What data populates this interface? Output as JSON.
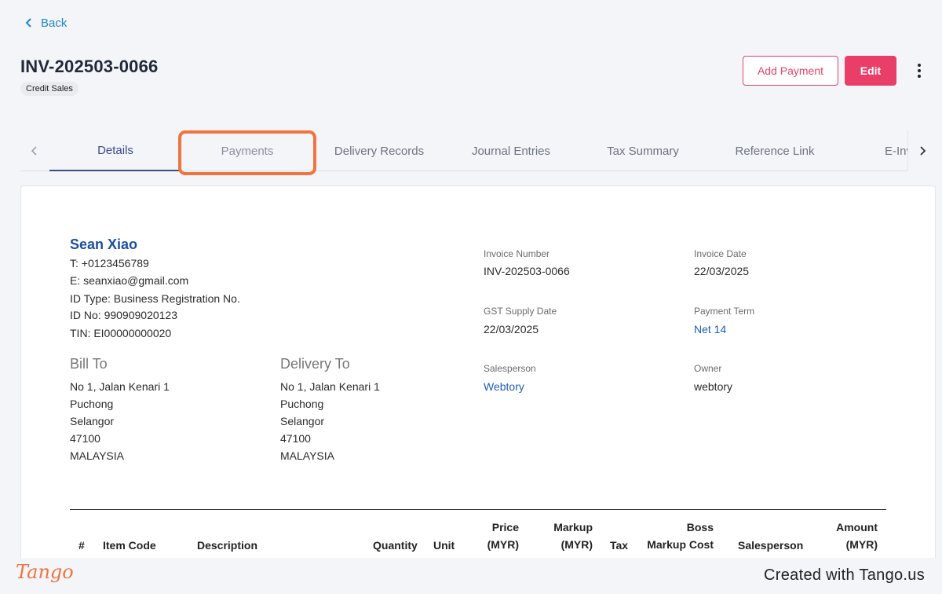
{
  "nav": {
    "back_label": "Back"
  },
  "header": {
    "invoice_no": "INV-202503-0066",
    "badge": "Credit Sales",
    "add_payment_label": "Add Payment",
    "edit_label": "Edit"
  },
  "tabs": [
    {
      "label": "Details"
    },
    {
      "label": "Payments"
    },
    {
      "label": "Delivery Records"
    },
    {
      "label": "Journal Entries"
    },
    {
      "label": "Tax Summary"
    },
    {
      "label": "Reference Link"
    },
    {
      "label": "E-Inv"
    }
  ],
  "customer": {
    "name": "Sean Xiao",
    "phone": "T: +0123456789",
    "email": "E: seanxiao@gmail.com",
    "id_type": "ID Type: Business Registration No.",
    "id_no": "ID No: 990909020123",
    "tin": "TIN: EI00000000020"
  },
  "bill_to": {
    "title": "Bill To",
    "lines": [
      "No 1, Jalan Kenari 1",
      "Puchong",
      "Selangor",
      "47100",
      "MALAYSIA"
    ]
  },
  "delivery_to": {
    "title": "Delivery To",
    "lines": [
      "No 1, Jalan Kenari 1",
      "Puchong",
      "Selangor",
      "47100",
      "MALAYSIA"
    ]
  },
  "meta": {
    "invoice_number_label": "Invoice Number",
    "invoice_number": "INV-202503-0066",
    "invoice_date_label": "Invoice Date",
    "invoice_date": "22/03/2025",
    "gst_supply_date_label": "GST Supply Date",
    "gst_supply_date": "22/03/2025",
    "payment_term_label": "Payment Term",
    "payment_term": "Net 14",
    "salesperson_label": "Salesperson",
    "salesperson": "Webtory",
    "owner_label": "Owner",
    "owner": "webtory"
  },
  "table_headers": {
    "num": "#",
    "item_code": "Item Code",
    "description": "Description",
    "quantity": "Quantity",
    "unit": "Unit",
    "price_1": "Price",
    "price_2": "(MYR)",
    "markup_1": "Markup",
    "markup_2": "(MYR)",
    "tax": "Tax",
    "boss_1": "Boss",
    "boss_2": "Markup Cost",
    "salesperson": "Salesperson",
    "amount_1": "Amount",
    "amount_2": "(MYR)"
  },
  "footer": {
    "logo": "Tango",
    "credit": "Created with Tango.us"
  },
  "colors": {
    "accent": "#e93e68",
    "link": "#1d5fb0",
    "highlight": "#f0743e",
    "active_tab": "#3b4a8a"
  }
}
